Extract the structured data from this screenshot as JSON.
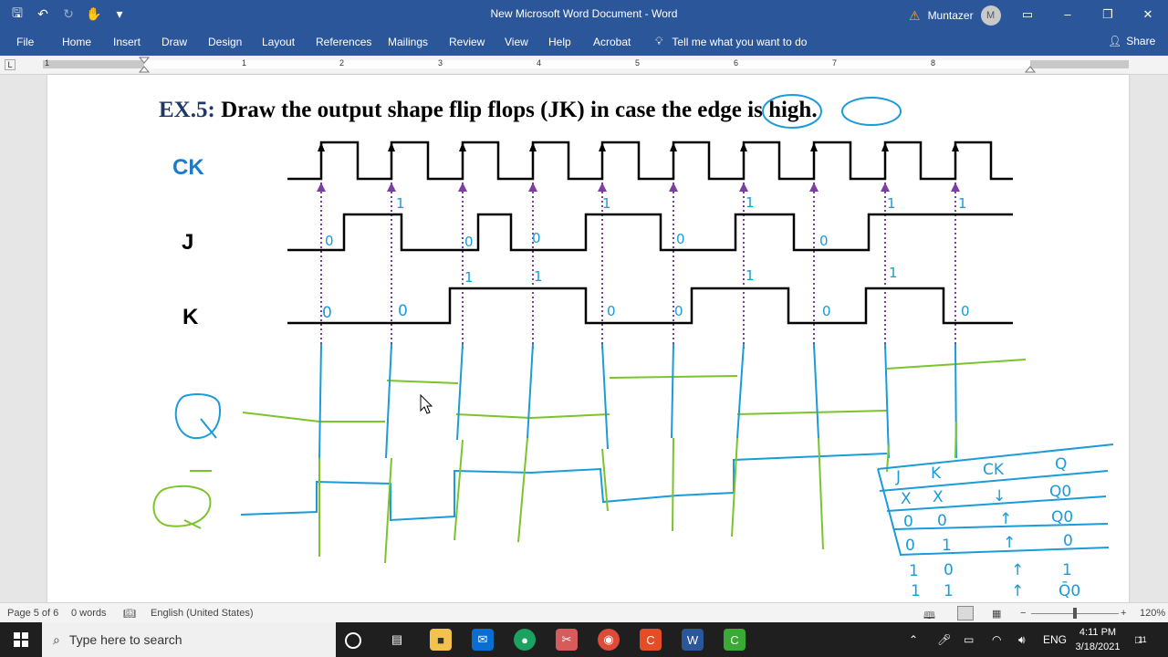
{
  "window": {
    "title": "New Microsoft Word Document  -  Word",
    "user": "Muntazer",
    "avatar_initial": "M"
  },
  "menu": {
    "tabs": [
      "File",
      "Home",
      "Insert",
      "Draw",
      "Design",
      "Layout",
      "References",
      "Mailings",
      "Review",
      "View",
      "Help",
      "Acrobat"
    ],
    "tell_me": "Tell me what you want to do",
    "share": "Share"
  },
  "ruler": {
    "numbers": [
      "1",
      "1",
      "2",
      "3",
      "4",
      "5",
      "6",
      "7",
      "8"
    ]
  },
  "document": {
    "heading_prefix": "EX.5:",
    "heading_text": "Draw the output shape flip flops (JK) in case the edge is high.",
    "signals": {
      "ck": "CK",
      "j": "J",
      "k": "K"
    },
    "j_values": [
      "0",
      "1",
      "0",
      "0",
      "1",
      "0",
      "1",
      "0",
      "1",
      "1"
    ],
    "k_values": [
      "0",
      "0",
      "1",
      "1",
      "0",
      "0",
      "1",
      "0",
      "1",
      "0"
    ],
    "truth_table": {
      "headers": [
        "J",
        "K",
        "CK",
        "Q"
      ],
      "rows": [
        [
          "X",
          "X",
          "↓",
          "Q0"
        ],
        [
          "0",
          "0",
          "↑",
          "Q0"
        ],
        [
          "0",
          "1",
          "↑",
          "0"
        ],
        [
          "1",
          "0",
          "↑",
          "1"
        ],
        [
          "1",
          "1",
          "↑",
          "Q̄0"
        ]
      ]
    }
  },
  "status": {
    "page": "Page 5 of 6",
    "words": "0 words",
    "language": "English (United States)",
    "zoom": "120%"
  },
  "taskbar": {
    "search_placeholder": "Type here to search",
    "lang": "ENG",
    "time": "4:11 PM",
    "date": "3/18/2021",
    "notifications": "11"
  },
  "colors": {
    "word_blue": "#2b579a",
    "ck_label": "#1e7ac7",
    "ink_blue": "#1b9bd8",
    "ink_green": "#7cc42c",
    "clock_arrow": "#7b3fa0"
  }
}
